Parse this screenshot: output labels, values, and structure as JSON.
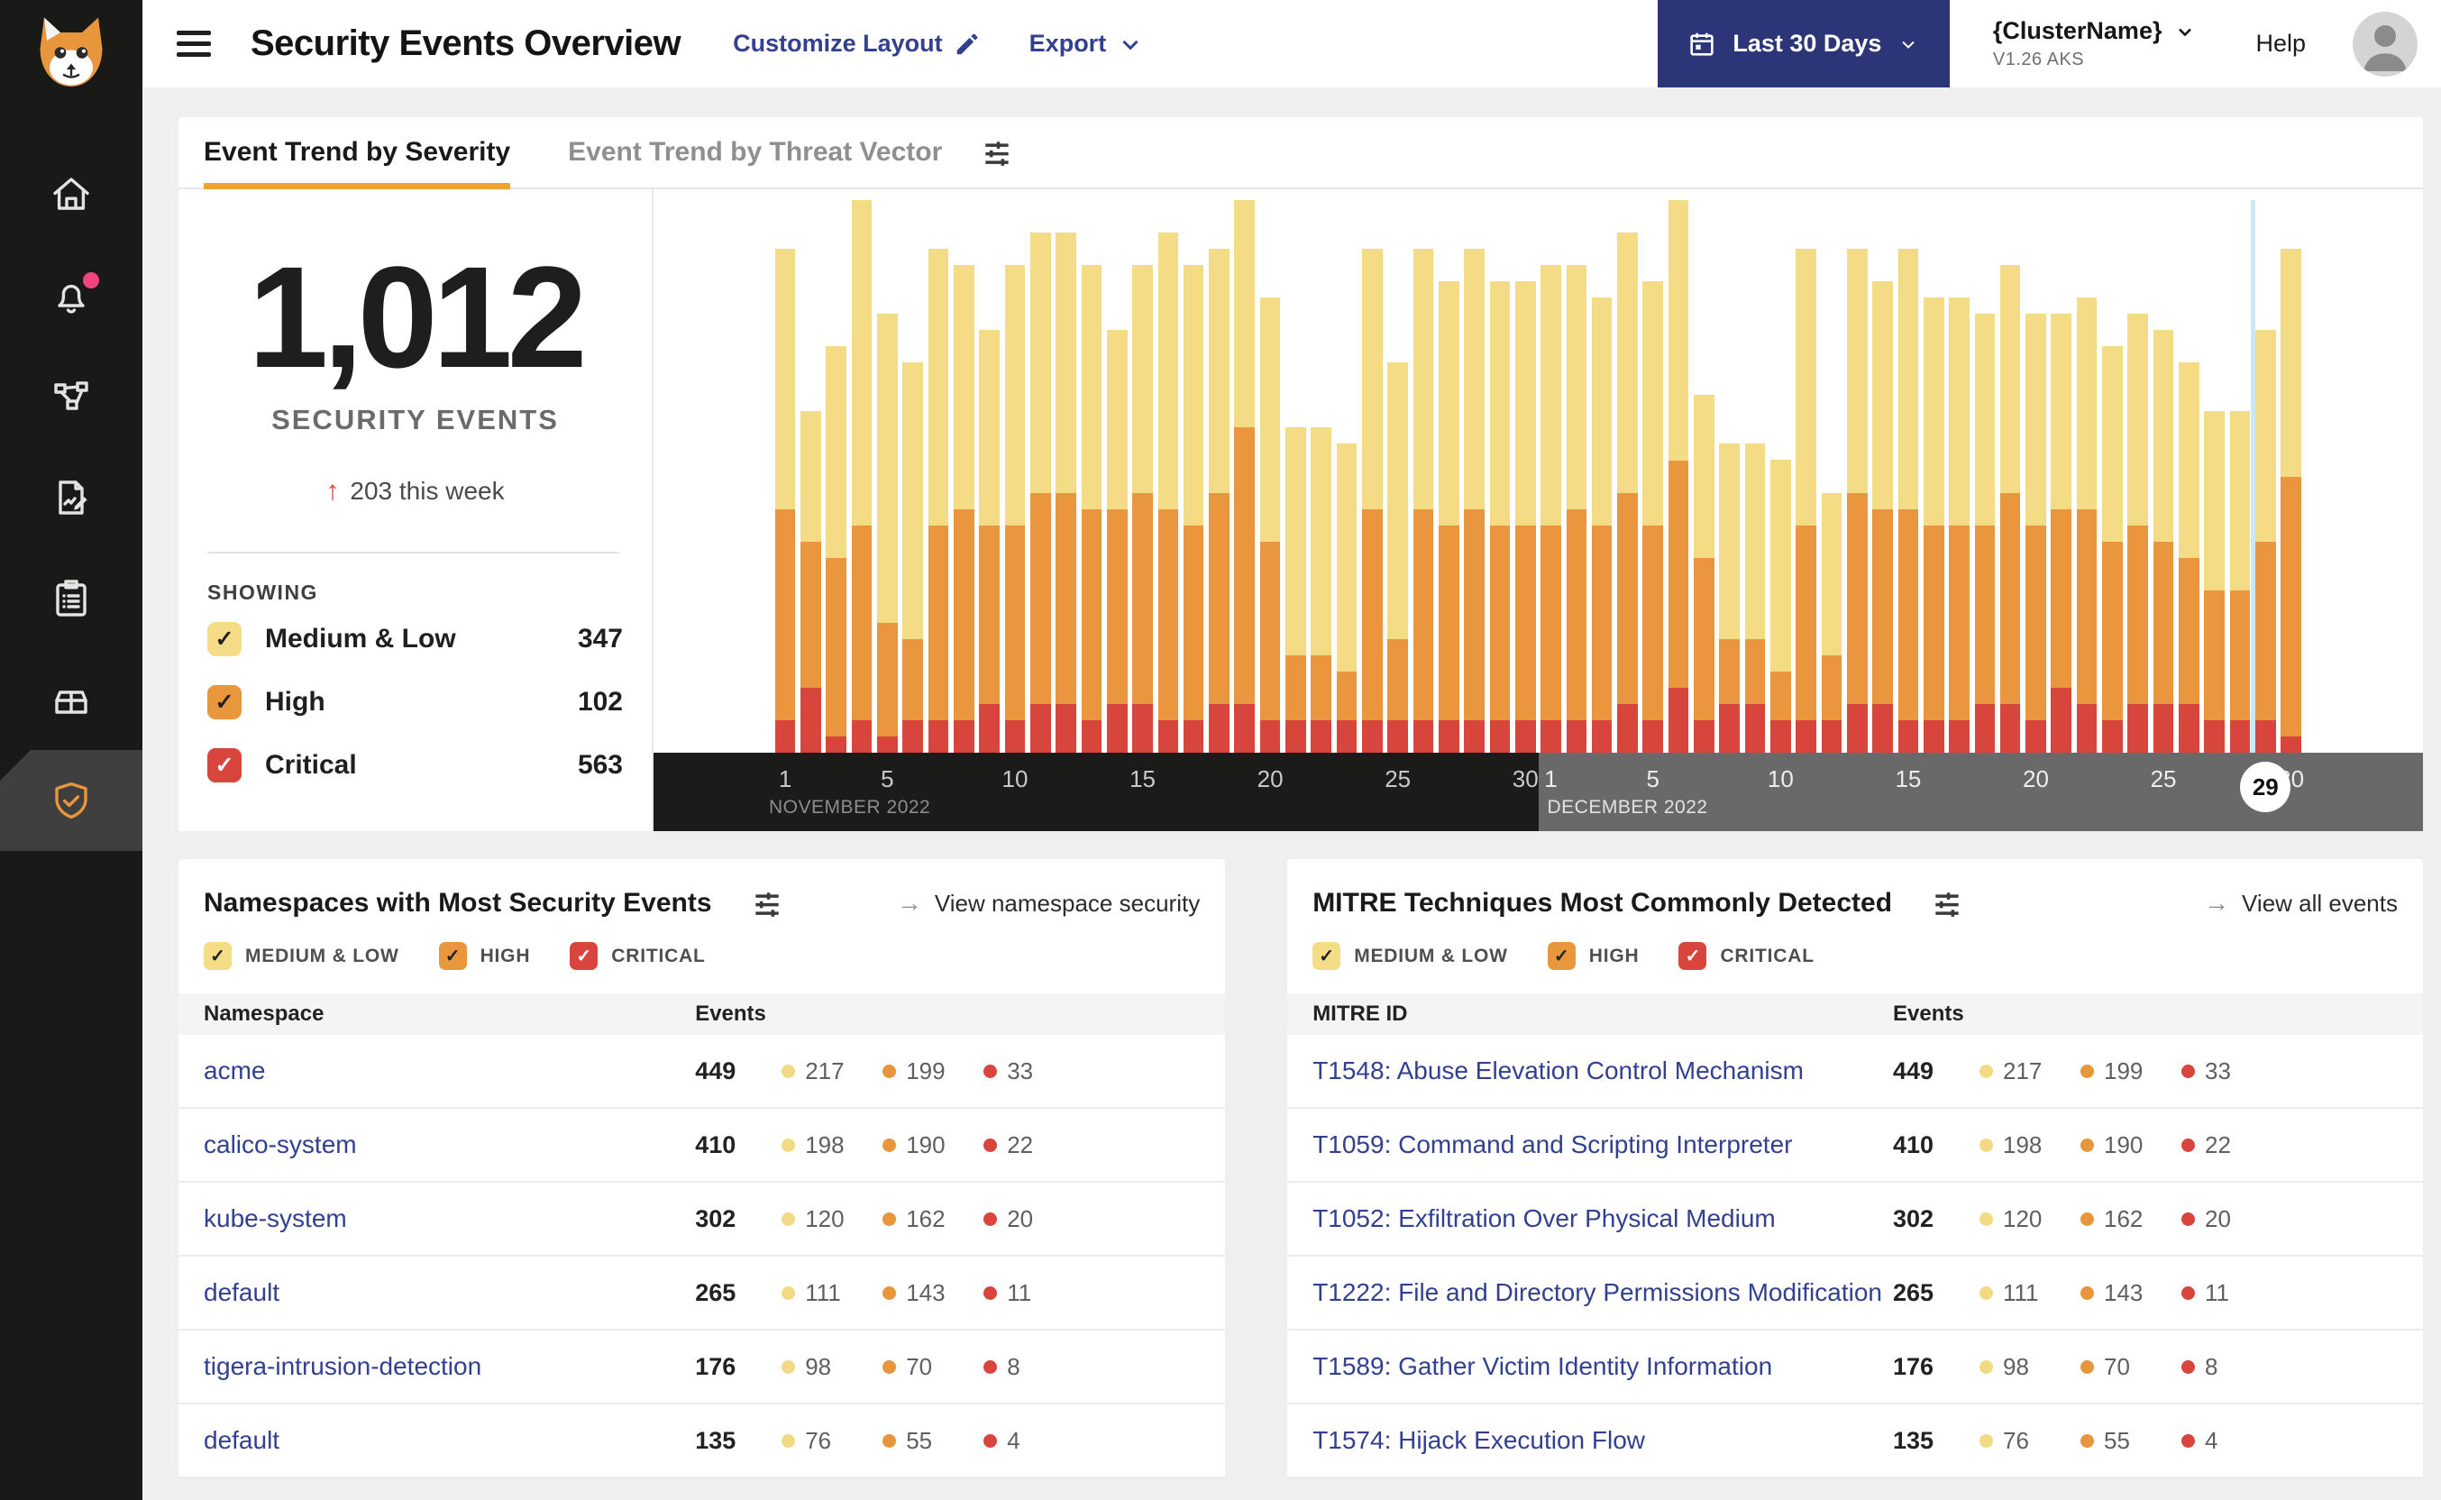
{
  "header": {
    "title": "Security Events Overview",
    "customize_layout": "Customize Layout",
    "export_label": "Export",
    "date_range": "Last 30 Days",
    "cluster_name": "{ClusterName}",
    "cluster_version": "V1.26 AKS",
    "help_label": "Help"
  },
  "sidebar": {
    "icons": [
      "tigera-cat-logo",
      "home-icon",
      "bell-icon",
      "network-icon",
      "report-icon",
      "clipboard-icon",
      "archive-icon",
      "shield-icon"
    ],
    "active_item": "shield-icon"
  },
  "tabs": [
    {
      "label": "Event Trend by Severity",
      "active": true
    },
    {
      "label": "Event Trend by Threat Vector",
      "active": false
    }
  ],
  "stats": {
    "total": "1,012",
    "label": "SECURITY EVENTS",
    "delta_arrow": "↑",
    "delta": "203 this week",
    "showing_label": "SHOWING",
    "filters": [
      {
        "label": "Medium & Low",
        "count": "347",
        "color": "#F5DC86",
        "check": "#222222"
      },
      {
        "label": "High",
        "count": "102",
        "color": "#E9973D",
        "check": "#222222"
      },
      {
        "label": "Critical",
        "count": "563",
        "color": "#D8453C",
        "check": "#FFFFFF"
      }
    ]
  },
  "chart_data": {
    "type": "bar",
    "stacked": true,
    "title": "Event Trend by Severity",
    "x_unit": "day",
    "months": [
      "NOVEMBER 2022",
      "DECEMBER 2022"
    ],
    "ticks": [
      1,
      5,
      10,
      15,
      20,
      25,
      30
    ],
    "marker_day": "29",
    "marker_month": "DECEMBER 2022",
    "ylim": [
      0,
      34
    ],
    "grid": false,
    "colors": {
      "medium_low": "#F4DC87",
      "high": "#E9963E",
      "critical": "#D7453C"
    },
    "series": [
      {
        "name": "medium_low",
        "label": "Medium & Low",
        "values": [
          16,
          8,
          13,
          20,
          19,
          17,
          17,
          15,
          12,
          16,
          16,
          16,
          15,
          11,
          14,
          17,
          16,
          15,
          14,
          15,
          14,
          14,
          14,
          16,
          17,
          16,
          15,
          16,
          15,
          15,
          16,
          15,
          14,
          16,
          15,
          16,
          10,
          12,
          12,
          13,
          17,
          10,
          15,
          14,
          16,
          14,
          14,
          13,
          14,
          13,
          12,
          13,
          12,
          13,
          13,
          12,
          11,
          11,
          13,
          14
        ]
      },
      {
        "name": "high",
        "label": "High",
        "values": [
          13,
          9,
          11,
          12,
          7,
          5,
          12,
          13,
          11,
          12,
          13,
          13,
          13,
          12,
          13,
          13,
          12,
          13,
          17,
          11,
          4,
          4,
          3,
          13,
          5,
          13,
          12,
          13,
          12,
          12,
          12,
          13,
          12,
          13,
          12,
          14,
          10,
          4,
          4,
          3,
          12,
          4,
          13,
          12,
          13,
          12,
          12,
          11,
          13,
          12,
          11,
          12,
          11,
          11,
          10,
          9,
          8,
          8,
          11,
          16
        ]
      },
      {
        "name": "critical",
        "label": "Critical",
        "values": [
          2,
          4,
          1,
          2,
          1,
          2,
          2,
          2,
          3,
          2,
          3,
          3,
          2,
          3,
          3,
          2,
          2,
          3,
          3,
          2,
          2,
          2,
          2,
          2,
          2,
          2,
          2,
          2,
          2,
          2,
          2,
          2,
          2,
          3,
          2,
          4,
          2,
          3,
          3,
          2,
          2,
          2,
          3,
          3,
          2,
          2,
          2,
          3,
          3,
          2,
          4,
          3,
          2,
          3,
          3,
          3,
          2,
          2,
          2,
          1
        ]
      }
    ]
  },
  "namespaces_panel": {
    "title": "Namespaces with Most Security Events",
    "link": "View namespace security",
    "link_arrow": "→",
    "filters": [
      "MEDIUM & LOW",
      "HIGH",
      "CRITICAL"
    ],
    "columns": [
      "Namespace",
      "Events"
    ],
    "rows": [
      {
        "name": "acme",
        "total": "449",
        "medium_low": "217",
        "high": "199",
        "critical": "33"
      },
      {
        "name": "calico-system",
        "total": "410",
        "medium_low": "198",
        "high": "190",
        "critical": "22"
      },
      {
        "name": "kube-system",
        "total": "302",
        "medium_low": "120",
        "high": "162",
        "critical": "20"
      },
      {
        "name": "default",
        "total": "265",
        "medium_low": "111",
        "high": "143",
        "critical": "11"
      },
      {
        "name": "tigera-intrusion-detection",
        "total": "176",
        "medium_low": "98",
        "high": "70",
        "critical": "8"
      },
      {
        "name": "default",
        "total": "135",
        "medium_low": "76",
        "high": "55",
        "critical": "4"
      }
    ]
  },
  "mitre_panel": {
    "title": "MITRE Techniques Most Commonly Detected",
    "link": "View all events",
    "link_arrow": "→",
    "filters": [
      "MEDIUM & LOW",
      "HIGH",
      "CRITICAL"
    ],
    "columns": [
      "MITRE ID",
      "Events"
    ],
    "rows": [
      {
        "name": "T1548: Abuse Elevation Control Mechanism",
        "total": "449",
        "medium_low": "217",
        "high": "199",
        "critical": "33"
      },
      {
        "name": "T1059: Command and Scripting Interpreter",
        "total": "410",
        "medium_low": "198",
        "high": "190",
        "critical": "22"
      },
      {
        "name": "T1052: Exfiltration Over Physical Medium",
        "total": "302",
        "medium_low": "120",
        "high": "162",
        "critical": "20"
      },
      {
        "name": "T1222: File and Directory Permissions Modification",
        "total": "265",
        "medium_low": "111",
        "high": "143",
        "critical": "11"
      },
      {
        "name": "T1589: Gather Victim Identity Information",
        "total": "176",
        "medium_low": "98",
        "high": "70",
        "critical": "8"
      },
      {
        "name": "T1574: Hijack Execution Flow",
        "total": "135",
        "medium_low": "76",
        "high": "55",
        "critical": "4"
      }
    ]
  },
  "colors": {
    "yellow": "#F2D983",
    "orange": "#E8963C",
    "red": "#D7453C",
    "accent_orange": "#F0A231",
    "navy_button": "#2B3577",
    "link_navy": "#32408F",
    "notification_pink": "#F0457E",
    "marker_blue": "#C9E8F5",
    "axis_november": "#1B1B19",
    "axis_december": "#696969"
  }
}
